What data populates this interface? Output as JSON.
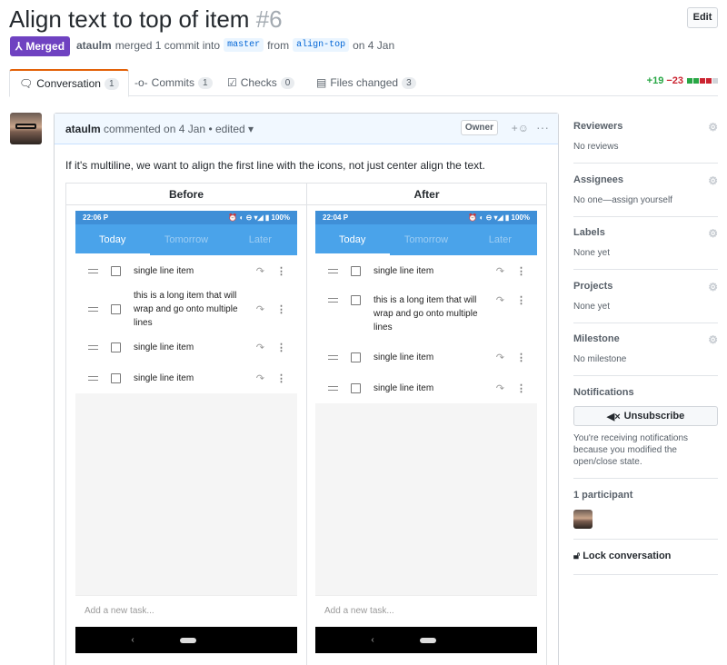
{
  "pr": {
    "title": "Align text to top of item",
    "number": "#6",
    "edit_label": "Edit"
  },
  "status": {
    "badge": "Merged",
    "author": "ataulm",
    "merged_text": "merged 1 commit into",
    "base_branch": "master",
    "from_text": "from",
    "head_branch": "align-top",
    "date_text": "on 4 Jan"
  },
  "tabs": [
    {
      "label": "Conversation",
      "count": "1"
    },
    {
      "label": "Commits",
      "count": "1"
    },
    {
      "label": "Checks",
      "count": "0"
    },
    {
      "label": "Files changed",
      "count": "3"
    }
  ],
  "diffstat": {
    "additions": "+19",
    "deletions": "−23"
  },
  "comment": {
    "author": "ataulm",
    "action": "commented on 4 Jan",
    "edited": "• edited ▾",
    "role": "Owner",
    "body": "If it's multiline, we want to align the first line with the icons, not just center align the text."
  },
  "table": {
    "headers": [
      "Before",
      "After"
    ]
  },
  "phones": [
    {
      "time": "22:06",
      "battery": "100%",
      "tabs": [
        "Today",
        "Tomorrow",
        "Later"
      ],
      "items": [
        "single line item",
        "this is a long item that will wrap and go onto multiple lines",
        "single line item",
        "single line item"
      ],
      "add_task": "Add a new task..."
    },
    {
      "time": "22:04",
      "battery": "100%",
      "tabs": [
        "Today",
        "Tomorrow",
        "Later"
      ],
      "items": [
        "single line item",
        "this is a long item that will wrap and go onto multiple lines",
        "single line item",
        "single line item"
      ],
      "add_task": "Add a new task..."
    }
  ],
  "sidebar": {
    "reviewers": {
      "title": "Reviewers",
      "value": "No reviews"
    },
    "assignees": {
      "title": "Assignees",
      "value": "No one—assign yourself"
    },
    "labels": {
      "title": "Labels",
      "value": "None yet"
    },
    "projects": {
      "title": "Projects",
      "value": "None yet"
    },
    "milestone": {
      "title": "Milestone",
      "value": "No milestone"
    },
    "notifications": {
      "title": "Notifications",
      "button": "Unsubscribe",
      "text": "You're receiving notifications because you modified the open/close state."
    },
    "participants": {
      "title": "1 participant"
    },
    "lock": {
      "label": "Lock conversation"
    }
  },
  "colors": {
    "merged": "#6f42c1",
    "accent": "#e36209",
    "additions": "#28a745",
    "deletions": "#cb2431",
    "phone_bar": "#4aa3ea"
  }
}
